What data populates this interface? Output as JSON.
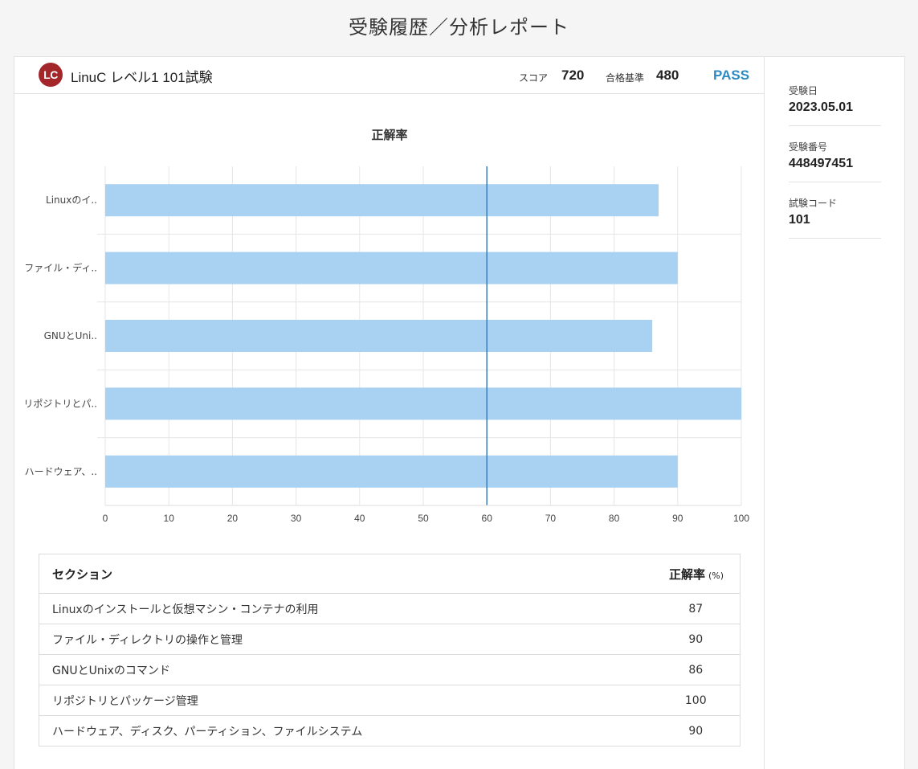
{
  "page_title": "受験履歴／分析レポート",
  "header": {
    "logo_text": "LC",
    "exam_name": "LinuC レベル1 101試験",
    "score_label": "スコア",
    "score_value": "720",
    "pass_label": "合格基準",
    "pass_value": "480",
    "result": "PASS"
  },
  "chart_data": {
    "type": "bar",
    "orientation": "horizontal",
    "title": "正解率",
    "categories": [
      "Linuxのイ..",
      "ファイル・ディ..",
      "GNUとUni..",
      "リポジトリとパ..",
      "ハードウェア、.."
    ],
    "values": [
      87,
      90,
      86,
      100,
      90
    ],
    "xlim": [
      0,
      100
    ],
    "xticks": [
      "0",
      "10",
      "20",
      "30",
      "40",
      "50",
      "60",
      "70",
      "80",
      "90",
      "100"
    ],
    "reference_line": 60,
    "grid": true,
    "bar_color": "#a9d1f2",
    "reference_color": "#3a7dbd"
  },
  "table": {
    "header_section": "セクション",
    "header_rate": "正解率",
    "header_unit": "(%)",
    "rows": [
      {
        "section": "Linuxのインストールと仮想マシン・コンテナの利用",
        "rate": "87"
      },
      {
        "section": "ファイル・ディレクトリの操作と管理",
        "rate": "90"
      },
      {
        "section": "GNUとUnixのコマンド",
        "rate": "86"
      },
      {
        "section": "リポジトリとパッケージ管理",
        "rate": "100"
      },
      {
        "section": "ハードウェア、ディスク、パーティション、ファイルシステム",
        "rate": "90"
      }
    ]
  },
  "sidebar": {
    "exam_date_label": "受験日",
    "exam_date": "2023.05.01",
    "exam_number_label": "受験番号",
    "exam_number": "448497451",
    "exam_code_label": "試験コード",
    "exam_code": "101"
  }
}
